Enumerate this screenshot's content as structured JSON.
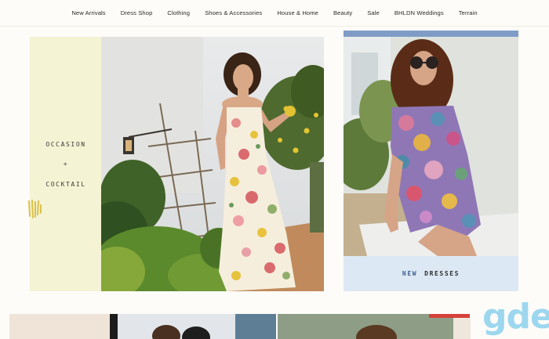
{
  "nav": {
    "items": [
      "New Arrivals",
      "Dress Shop",
      "Clothing",
      "Shoes & Accessories",
      "House & Home",
      "Beauty",
      "Sale",
      "BHLDN Weddings",
      "Terrain"
    ]
  },
  "hero": {
    "line1": "OCCASION",
    "line2": "+",
    "line3": "COCKTAIL"
  },
  "promo_right": {
    "word1": "NEW",
    "word2": "DRESSES"
  },
  "watermark": "gde",
  "colors": {
    "panel_yellow": "#f4f3d3",
    "caption_blue": "#dce8f3",
    "accent_blue": "#3e5f8f",
    "watermark_blue": "#93d4ef"
  }
}
